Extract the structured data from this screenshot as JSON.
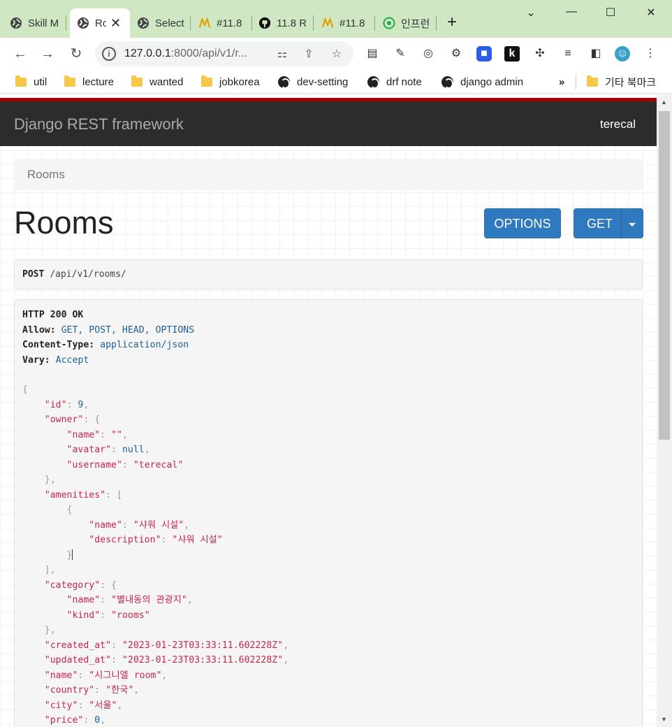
{
  "browser": {
    "tabs": [
      {
        "label": "Skill M",
        "icon": "globe-icon"
      },
      {
        "label": "Ro",
        "icon": "globe-icon",
        "active": true
      },
      {
        "label": "Select",
        "icon": "globe-icon"
      },
      {
        "label": "#11.8",
        "icon": "bear-icon"
      },
      {
        "label": "11.8 R",
        "icon": "github-icon"
      },
      {
        "label": "#11.8",
        "icon": "bear-icon"
      },
      {
        "label": "인프런",
        "icon": "inflearn-icon"
      }
    ],
    "new_tab": "+",
    "url_host": "127.0.0.1",
    "url_rest": ":8000/api/v1/r...",
    "bookmarks": [
      {
        "label": "util",
        "type": "folder"
      },
      {
        "label": "lecture",
        "type": "folder"
      },
      {
        "label": "wanted",
        "type": "folder"
      },
      {
        "label": "jobkorea",
        "type": "folder"
      },
      {
        "label": "dev-setting",
        "type": "site"
      },
      {
        "label": "drf note",
        "type": "site"
      },
      {
        "label": "django admin",
        "type": "site"
      }
    ],
    "bookmarks_overflow": "»",
    "other_bookmarks": "기타 북마크"
  },
  "drf": {
    "brand": "Django REST framework",
    "user": "terecal",
    "breadcrumb": "Rooms",
    "title": "Rooms",
    "options_button": "OPTIONS",
    "get_button": "GET",
    "request": {
      "method": "POST",
      "path": "/api/v1/rooms/"
    },
    "response_headers": {
      "status": "HTTP 200 OK",
      "allow_key": "Allow:",
      "allow_val": "GET, POST, HEAD, OPTIONS",
      "ctype_key": "Content-Type:",
      "ctype_val": "application/json",
      "vary_key": "Vary:",
      "vary_val": "Accept"
    },
    "json": {
      "id": "9",
      "owner_name": "\"\"",
      "owner_avatar": "null",
      "owner_username": "\"terecal\"",
      "amenity_name": "\"샤워 시설\"",
      "amenity_description": "\"샤워 시설\"",
      "category_name": "\"별내동의 관광지\"",
      "category_kind": "\"rooms\"",
      "created_at": "\"2023-01-23T03:33:11.602228Z\"",
      "updated_at": "\"2023-01-23T03:33:11.602228Z\"",
      "name": "\"시그니엘 room\"",
      "country": "\"한국\"",
      "city": "\"서울\"",
      "price": "0"
    }
  }
}
